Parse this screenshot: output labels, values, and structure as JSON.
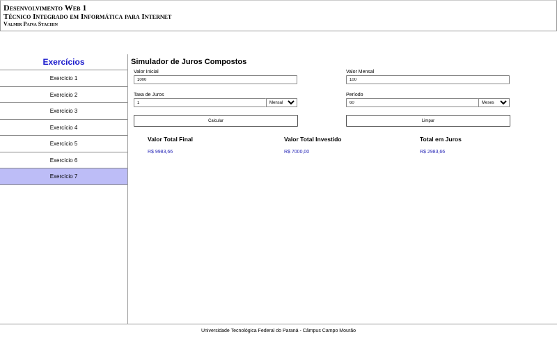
{
  "header": {
    "title": "Desenvolvimento Web 1",
    "subtitle": "Técnico Integrado em Informática para Internet",
    "author": "Valmir Paiva Stachin"
  },
  "sidebar": {
    "title": "Exercícios",
    "items": [
      {
        "label": "Exercício 1",
        "active": false
      },
      {
        "label": "Exercício 2",
        "active": false
      },
      {
        "label": "Exercício 3",
        "active": false
      },
      {
        "label": "Exercício 4",
        "active": false
      },
      {
        "label": "Exercício 5",
        "active": false
      },
      {
        "label": "Exercício 6",
        "active": false
      },
      {
        "label": "Exercício 7",
        "active": true
      }
    ],
    "active_color": "#bdbdf7"
  },
  "main": {
    "title": "Simulador de Juros Compostos",
    "form": {
      "valor_inicial": {
        "label": "Valor Inicial",
        "value": "1000"
      },
      "valor_mensal": {
        "label": "Valor Mensal",
        "value": "100"
      },
      "taxa": {
        "label": "Taxa de Juros",
        "value": "1",
        "unit": "Mensal"
      },
      "periodo": {
        "label": "Período",
        "value": "60",
        "unit": "Meses"
      }
    },
    "buttons": {
      "calcular": "Calcular",
      "limpar": "Limpar"
    },
    "results": {
      "total_final": {
        "label": "Valor Total Final",
        "value": "R$ 9983,66"
      },
      "total_investido": {
        "label": "Valor Total Investido",
        "value": "R$ 7000,00"
      },
      "total_juros": {
        "label": "Total em Juros",
        "value": "R$ 2983,66"
      }
    },
    "accent_color": "#2a2ab8"
  },
  "footer": {
    "text": "Universidade Tecnológica Federal do Paraná - Câmpus Campo Mourão"
  }
}
